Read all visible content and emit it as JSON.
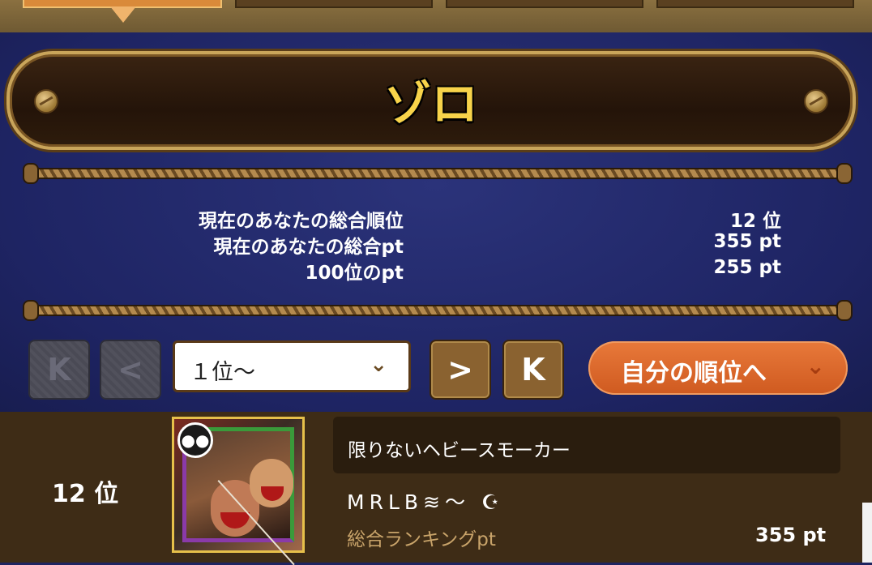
{
  "banner": {
    "title": "ゾロ"
  },
  "stats": [
    {
      "label": "現在のあなたの総合順位",
      "value": "12 位"
    },
    {
      "label": "現在のあなたの総合pt",
      "value": "355 pt"
    },
    {
      "label": "100位のpt",
      "value": "255 pt"
    }
  ],
  "pagination": {
    "first_icon": "first-page-icon",
    "first_label": "K",
    "prev_icon": "previous-page-icon",
    "prev_label": "<",
    "select_value": "１位〜",
    "select_chevron": "⌄",
    "next_icon": "next-page-icon",
    "next_label": ">",
    "last_icon": "last-page-icon",
    "last_label": "K",
    "my_rank_button": "自分の順位へ",
    "my_rank_chevron": "⌄"
  },
  "entry": {
    "rank": "12 位",
    "message": "限りないヘビースモーカー",
    "player_name": "MRLB≋〜 ☪",
    "points_label": "総合ランキングpt",
    "points_value": "355 pt",
    "badge_icon": "friends-icon"
  },
  "colors": {
    "panel_bg": "#1f2460",
    "title_gold": "#f7d34a",
    "my_rank_orange": "#e06a2c",
    "row_bg": "#3e2c16",
    "points_label": "#c9a46a"
  }
}
